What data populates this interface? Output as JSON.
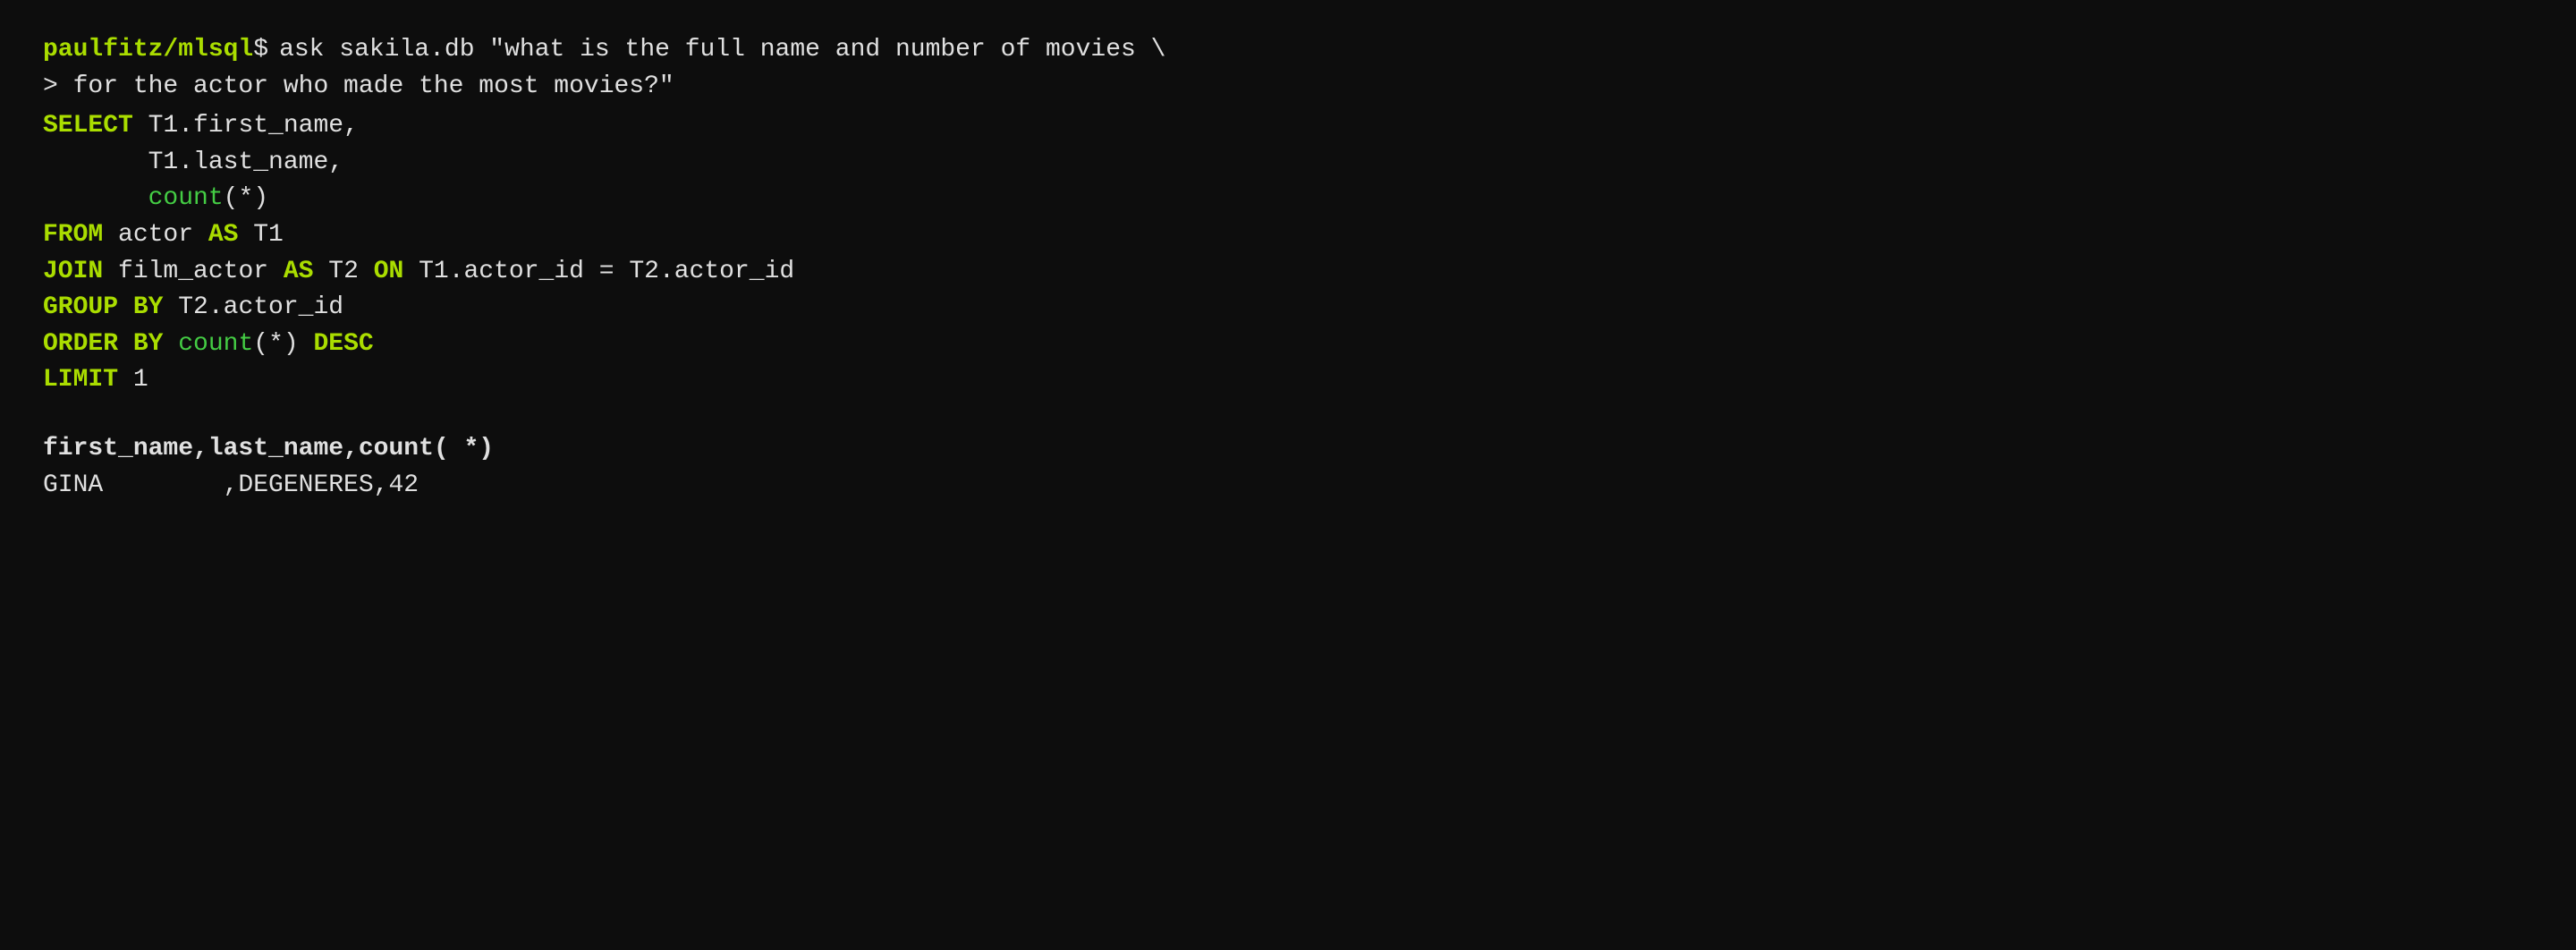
{
  "terminal": {
    "prompt": {
      "user": "paulfitz/mlsql",
      "symbol": "$",
      "command_line1": " ask sakila.db \"what is the full name and number of movies \\",
      "command_line2": "> for the actor who made the most movies?\""
    },
    "sql": {
      "line1_kw": "SELECT",
      "line1_rest": " T1.first_name,",
      "line2": "       T1.last_name,",
      "line3_fn": "       count",
      "line3_rest": "(*)",
      "line4_kw": "FROM",
      "line4_rest": " actor ",
      "line4_kw2": "AS",
      "line4_rest2": " T1",
      "line5_kw": "JOIN",
      "line5_rest": " film_actor ",
      "line5_kw2": "AS",
      "line5_rest2": " T2 ",
      "line5_kw3": "ON",
      "line5_rest3": " T1.actor_id = T2.actor_id",
      "line6_kw": "GROUP",
      "line6_kw2": "BY",
      "line6_rest": " T2.actor_id",
      "line7_kw": "ORDER",
      "line7_kw2": "BY",
      "line7_fn": " count",
      "line7_fn_rest": "(*) ",
      "line7_kw3": "DESC",
      "line8_kw": "LIMIT",
      "line8_rest": " 1"
    },
    "result": {
      "header": "first_name,last_name,count( *)",
      "row": "GINA        ,DEGENERES,42"
    }
  }
}
